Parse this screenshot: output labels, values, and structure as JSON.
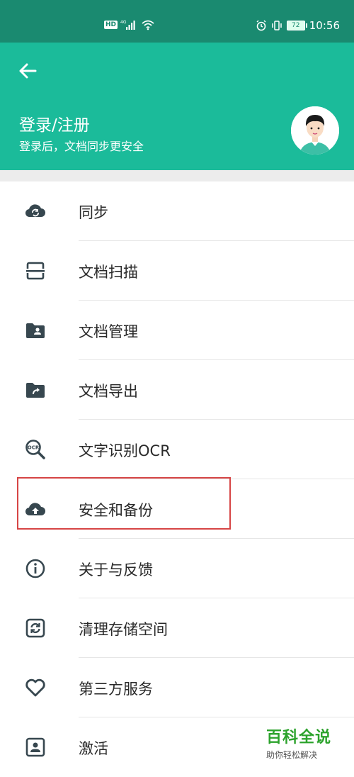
{
  "status_bar": {
    "hd": "HD",
    "network": "4G",
    "battery": "72",
    "time": "10:56"
  },
  "header": {
    "title": "登录/注册",
    "subtitle": "登录后，文档同步更安全"
  },
  "menu": [
    {
      "label": "同步",
      "icon": "cloud-sync-icon"
    },
    {
      "label": "文档扫描",
      "icon": "scan-icon"
    },
    {
      "label": "文档管理",
      "icon": "folder-person-icon"
    },
    {
      "label": "文档导出",
      "icon": "folder-export-icon"
    },
    {
      "label": "文字识别OCR",
      "icon": "ocr-icon"
    },
    {
      "label": "安全和备份",
      "icon": "cloud-upload-icon"
    },
    {
      "label": "关于与反馈",
      "icon": "info-icon"
    },
    {
      "label": "清理存储空间",
      "icon": "clean-icon"
    },
    {
      "label": "第三方服务",
      "icon": "heart-icon"
    },
    {
      "label": "激活",
      "icon": "account-box-icon"
    }
  ],
  "watermark": {
    "title": "百科全说",
    "subtitle": "助你轻松解决"
  },
  "colors": {
    "header": "#1bbb9a",
    "statusbar": "#1a8a70",
    "icon": "#37474f",
    "highlight": "#d64545"
  }
}
